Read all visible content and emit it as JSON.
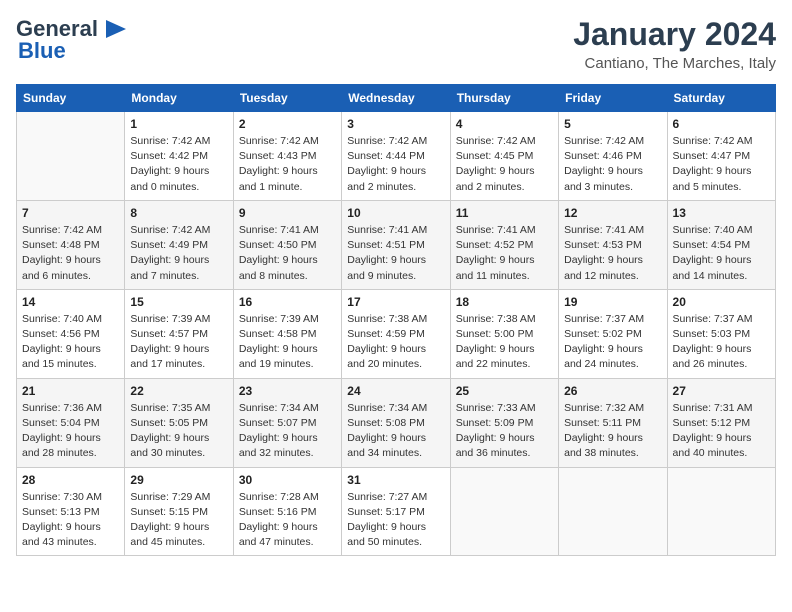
{
  "logo": {
    "line1": "General",
    "line2": "Blue",
    "arrow": "▶"
  },
  "title": "January 2024",
  "subtitle": "Cantiano, The Marches, Italy",
  "days_header": [
    "Sunday",
    "Monday",
    "Tuesday",
    "Wednesday",
    "Thursday",
    "Friday",
    "Saturday"
  ],
  "weeks": [
    [
      {
        "num": "",
        "info": ""
      },
      {
        "num": "1",
        "info": "Sunrise: 7:42 AM\nSunset: 4:42 PM\nDaylight: 9 hours\nand 0 minutes."
      },
      {
        "num": "2",
        "info": "Sunrise: 7:42 AM\nSunset: 4:43 PM\nDaylight: 9 hours\nand 1 minute."
      },
      {
        "num": "3",
        "info": "Sunrise: 7:42 AM\nSunset: 4:44 PM\nDaylight: 9 hours\nand 2 minutes."
      },
      {
        "num": "4",
        "info": "Sunrise: 7:42 AM\nSunset: 4:45 PM\nDaylight: 9 hours\nand 2 minutes."
      },
      {
        "num": "5",
        "info": "Sunrise: 7:42 AM\nSunset: 4:46 PM\nDaylight: 9 hours\nand 3 minutes."
      },
      {
        "num": "6",
        "info": "Sunrise: 7:42 AM\nSunset: 4:47 PM\nDaylight: 9 hours\nand 5 minutes."
      }
    ],
    [
      {
        "num": "7",
        "info": "Sunrise: 7:42 AM\nSunset: 4:48 PM\nDaylight: 9 hours\nand 6 minutes."
      },
      {
        "num": "8",
        "info": "Sunrise: 7:42 AM\nSunset: 4:49 PM\nDaylight: 9 hours\nand 7 minutes."
      },
      {
        "num": "9",
        "info": "Sunrise: 7:41 AM\nSunset: 4:50 PM\nDaylight: 9 hours\nand 8 minutes."
      },
      {
        "num": "10",
        "info": "Sunrise: 7:41 AM\nSunset: 4:51 PM\nDaylight: 9 hours\nand 9 minutes."
      },
      {
        "num": "11",
        "info": "Sunrise: 7:41 AM\nSunset: 4:52 PM\nDaylight: 9 hours\nand 11 minutes."
      },
      {
        "num": "12",
        "info": "Sunrise: 7:41 AM\nSunset: 4:53 PM\nDaylight: 9 hours\nand 12 minutes."
      },
      {
        "num": "13",
        "info": "Sunrise: 7:40 AM\nSunset: 4:54 PM\nDaylight: 9 hours\nand 14 minutes."
      }
    ],
    [
      {
        "num": "14",
        "info": "Sunrise: 7:40 AM\nSunset: 4:56 PM\nDaylight: 9 hours\nand 15 minutes."
      },
      {
        "num": "15",
        "info": "Sunrise: 7:39 AM\nSunset: 4:57 PM\nDaylight: 9 hours\nand 17 minutes."
      },
      {
        "num": "16",
        "info": "Sunrise: 7:39 AM\nSunset: 4:58 PM\nDaylight: 9 hours\nand 19 minutes."
      },
      {
        "num": "17",
        "info": "Sunrise: 7:38 AM\nSunset: 4:59 PM\nDaylight: 9 hours\nand 20 minutes."
      },
      {
        "num": "18",
        "info": "Sunrise: 7:38 AM\nSunset: 5:00 PM\nDaylight: 9 hours\nand 22 minutes."
      },
      {
        "num": "19",
        "info": "Sunrise: 7:37 AM\nSunset: 5:02 PM\nDaylight: 9 hours\nand 24 minutes."
      },
      {
        "num": "20",
        "info": "Sunrise: 7:37 AM\nSunset: 5:03 PM\nDaylight: 9 hours\nand 26 minutes."
      }
    ],
    [
      {
        "num": "21",
        "info": "Sunrise: 7:36 AM\nSunset: 5:04 PM\nDaylight: 9 hours\nand 28 minutes."
      },
      {
        "num": "22",
        "info": "Sunrise: 7:35 AM\nSunset: 5:05 PM\nDaylight: 9 hours\nand 30 minutes."
      },
      {
        "num": "23",
        "info": "Sunrise: 7:34 AM\nSunset: 5:07 PM\nDaylight: 9 hours\nand 32 minutes."
      },
      {
        "num": "24",
        "info": "Sunrise: 7:34 AM\nSunset: 5:08 PM\nDaylight: 9 hours\nand 34 minutes."
      },
      {
        "num": "25",
        "info": "Sunrise: 7:33 AM\nSunset: 5:09 PM\nDaylight: 9 hours\nand 36 minutes."
      },
      {
        "num": "26",
        "info": "Sunrise: 7:32 AM\nSunset: 5:11 PM\nDaylight: 9 hours\nand 38 minutes."
      },
      {
        "num": "27",
        "info": "Sunrise: 7:31 AM\nSunset: 5:12 PM\nDaylight: 9 hours\nand 40 minutes."
      }
    ],
    [
      {
        "num": "28",
        "info": "Sunrise: 7:30 AM\nSunset: 5:13 PM\nDaylight: 9 hours\nand 43 minutes."
      },
      {
        "num": "29",
        "info": "Sunrise: 7:29 AM\nSunset: 5:15 PM\nDaylight: 9 hours\nand 45 minutes."
      },
      {
        "num": "30",
        "info": "Sunrise: 7:28 AM\nSunset: 5:16 PM\nDaylight: 9 hours\nand 47 minutes."
      },
      {
        "num": "31",
        "info": "Sunrise: 7:27 AM\nSunset: 5:17 PM\nDaylight: 9 hours\nand 50 minutes."
      },
      {
        "num": "",
        "info": ""
      },
      {
        "num": "",
        "info": ""
      },
      {
        "num": "",
        "info": ""
      }
    ]
  ]
}
